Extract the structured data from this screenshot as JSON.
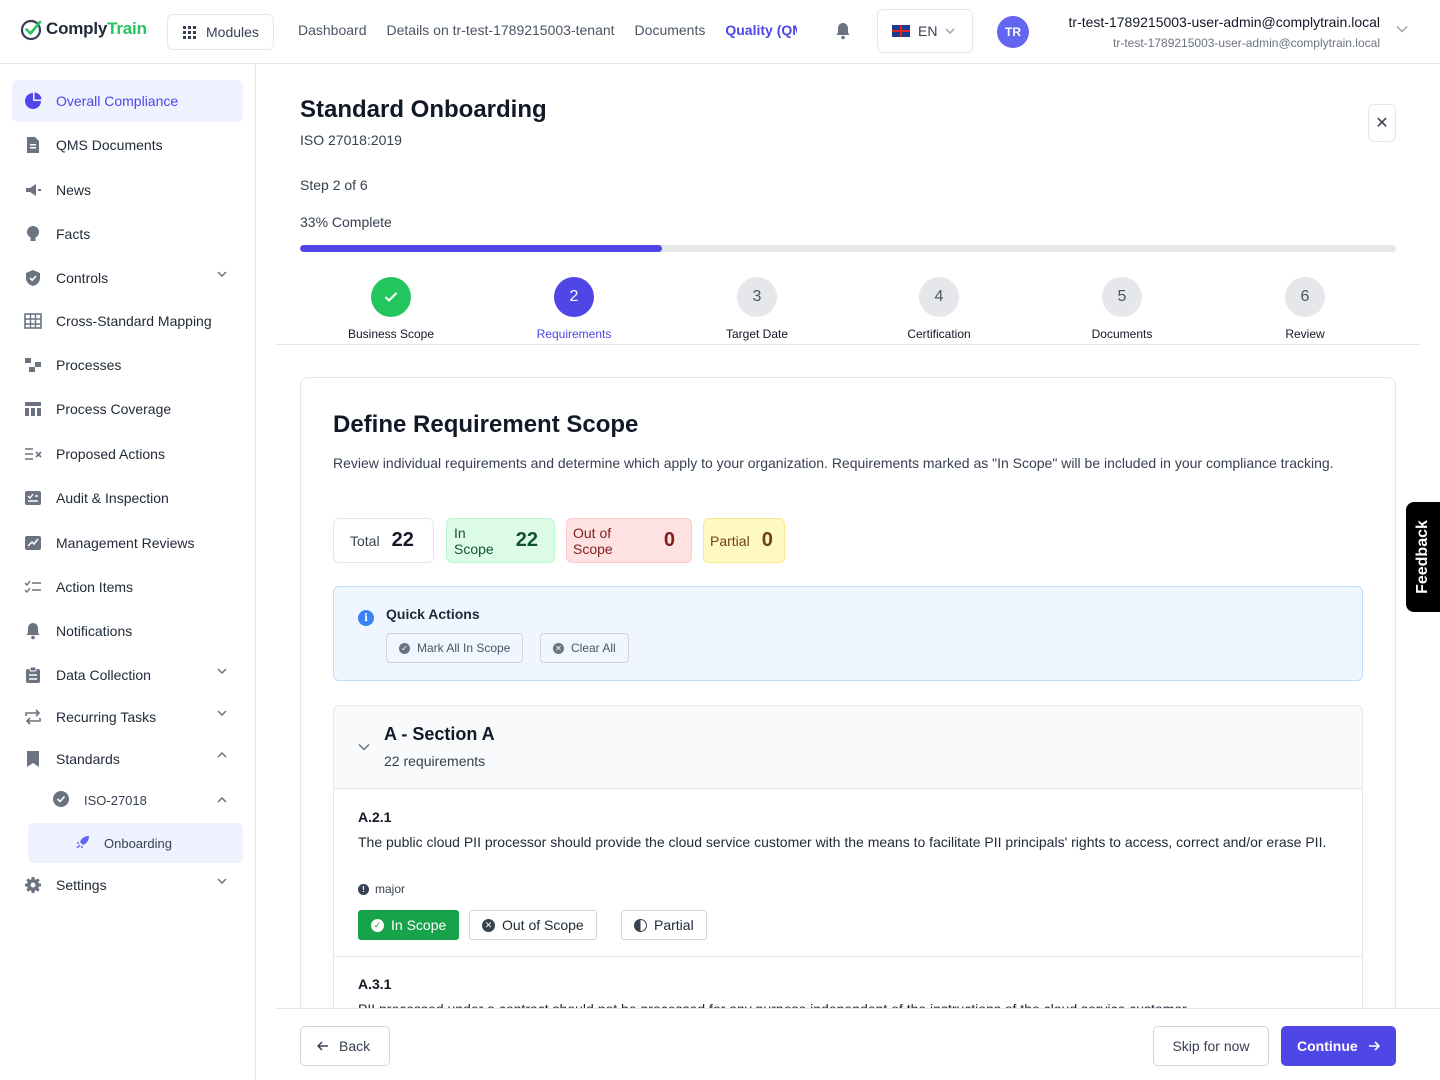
{
  "app": {
    "logo_prefix": "Comply",
    "logo_suffix": "Train",
    "modules_label": "Modules",
    "nav": [
      "Dashboard",
      "Details on tr-test-1789215003-tenant",
      "Documents",
      "Quality (QM"
    ],
    "language": "EN",
    "user_initials": "TR",
    "user_name": "tr-test-1789215003-user-admin@complytrain.local",
    "user_email": "tr-test-1789215003-user-admin@complytrain.local",
    "accent_color": "#4f46e5"
  },
  "sidebar": {
    "items": [
      {
        "label": "Overall Compliance",
        "icon": "pie-chart-icon",
        "active": true
      },
      {
        "label": "QMS Documents",
        "icon": "document-icon"
      },
      {
        "label": "News",
        "icon": "megaphone-icon"
      },
      {
        "label": "Facts",
        "icon": "lightbulb-icon"
      },
      {
        "label": "Controls",
        "icon": "shield-icon",
        "expand": "down"
      },
      {
        "label": "Cross-Standard Mapping",
        "icon": "table-grid-icon"
      },
      {
        "label": "Processes",
        "icon": "process-icon"
      },
      {
        "label": "Process Coverage",
        "icon": "columns-icon"
      },
      {
        "label": "Proposed Actions",
        "icon": "list-x-icon"
      },
      {
        "label": "Audit & Inspection",
        "icon": "checklist-box-icon"
      },
      {
        "label": "Management Reviews",
        "icon": "chart-review-icon"
      },
      {
        "label": "Action Items",
        "icon": "list-check-icon"
      },
      {
        "label": "Notifications",
        "icon": "bell-icon"
      },
      {
        "label": "Data Collection",
        "icon": "clipboard-icon",
        "expand": "down"
      },
      {
        "label": "Recurring Tasks",
        "icon": "repeat-icon",
        "expand": "down"
      },
      {
        "label": "Standards",
        "icon": "bookmark-icon",
        "expand": "up"
      }
    ],
    "standard_item": {
      "label": "ISO-27018",
      "icon": "badge-check-icon"
    },
    "onboarding_item": {
      "label": "Onboarding",
      "icon": "rocket-icon"
    },
    "settings_item": {
      "label": "Settings",
      "icon": "gear-icon"
    }
  },
  "header": {
    "title": "Standard Onboarding",
    "subtitle": "ISO 27018:2019",
    "step_text": "Step 2 of 6",
    "percent_text": "33% Complete",
    "progress": 0.33
  },
  "steps": [
    {
      "number": "1",
      "label": "Business Scope",
      "state": "done"
    },
    {
      "number": "2",
      "label": "Requirements",
      "state": "current"
    },
    {
      "number": "3",
      "label": "Target Date",
      "state": "todo"
    },
    {
      "number": "4",
      "label": "Certification",
      "state": "todo"
    },
    {
      "number": "5",
      "label": "Documents",
      "state": "todo"
    },
    {
      "number": "6",
      "label": "Review",
      "state": "todo"
    }
  ],
  "scope": {
    "title": "Define Requirement Scope",
    "description": "Review individual requirements and determine which apply to your organization. Requirements marked as \"In Scope\" will be included in your compliance tracking.",
    "stats": {
      "total_label": "Total",
      "total": "22",
      "in_label": "In Scope",
      "in": "22",
      "out_label": "Out of Scope",
      "out": "0",
      "partial_label": "Partial",
      "partial": "0"
    },
    "quick_actions": {
      "title": "Quick Actions",
      "mark_all": "Mark All In Scope",
      "clear_all": "Clear All"
    },
    "section": {
      "title": "A - Section A",
      "count": "22 requirements"
    },
    "requirements": [
      {
        "code": "A.2.1",
        "text": "The public cloud PII processor should provide the cloud service customer with the means to facilitate PII principals' rights to access, correct and/or erase PII.",
        "severity": "major",
        "options": [
          "In Scope",
          "Out of Scope",
          "Partial"
        ],
        "selected": "In Scope"
      },
      {
        "code": "A.3.1",
        "text": "PII processed under a contract should not be processed for any purpose independent of the instructions of the cloud service customer."
      }
    ]
  },
  "footer": {
    "back": "Back",
    "skip": "Skip for now",
    "continue": "Continue"
  },
  "feedback_label": "Feedback"
}
